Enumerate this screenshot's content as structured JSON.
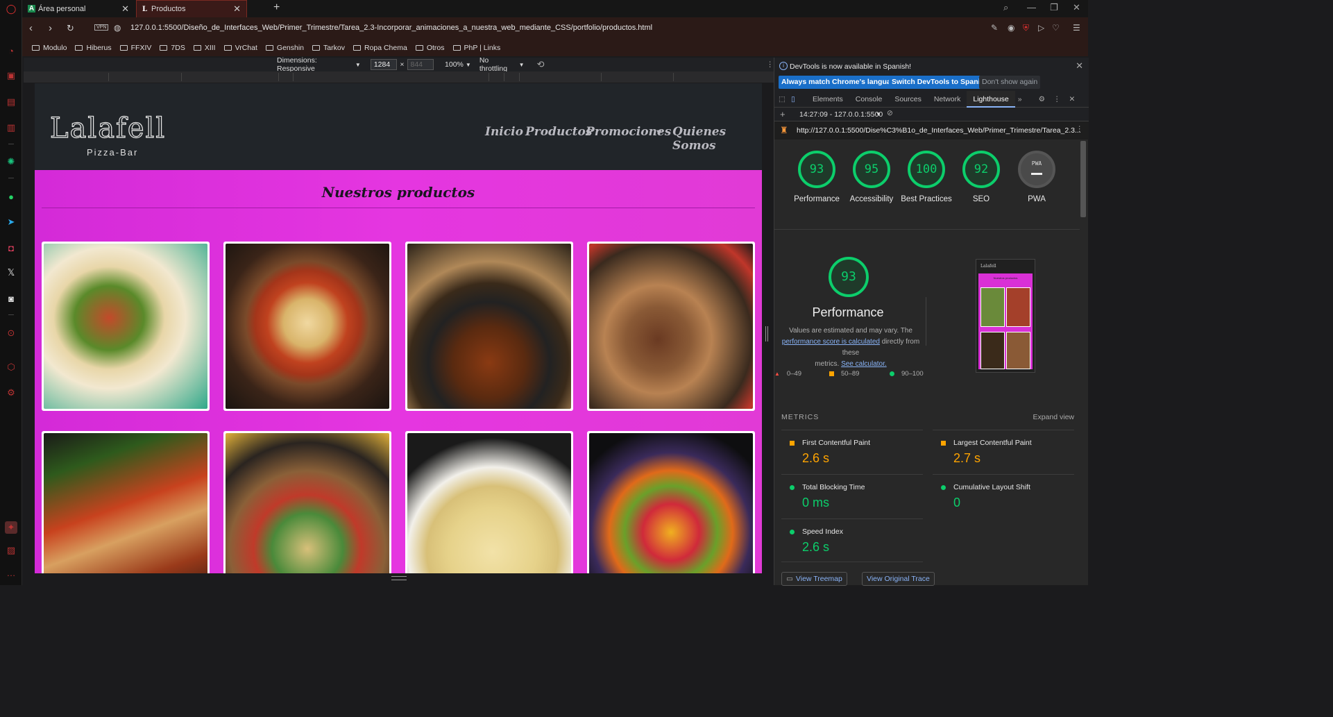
{
  "browser": {
    "tabs": [
      {
        "title": "Área personal",
        "favicon": "A"
      },
      {
        "title": "Productos",
        "favicon": "L"
      }
    ],
    "url": "127.0.0.1:5500/Diseño_de_Interfaces_Web/Primer_Trimestre/Tarea_2.3-Incorporar_animaciones_a_nuestra_web_mediante_CSS/portfolio/productos.html",
    "vpn_label": "VPN",
    "bookmarks": [
      "Modulo",
      "Hiberus",
      "FFXIV",
      "7DS",
      "XIII",
      "VrChat",
      "Genshin",
      "Tarkov",
      "Ropa Chema",
      "Otros",
      "PhP | Links"
    ]
  },
  "device_toolbar": {
    "dimensions": "Dimensions: Responsive",
    "width": "1284",
    "height_placeholder": "844",
    "times": "×",
    "zoom": "100%",
    "throttling": "No throttling"
  },
  "site": {
    "logo": "Lalafell",
    "logo_sub": "Pizza-Bar",
    "menu": [
      "Inicio",
      "Productos",
      "Promociones",
      "Quienes Somos"
    ],
    "section_title": "Nuestros productos",
    "products": [
      "tacos",
      "pizza",
      "stew",
      "steak",
      "lasagna",
      "chickpea-salad",
      "pasta",
      "fruit-salad"
    ]
  },
  "devtools": {
    "info": "DevTools is now available in Spanish!",
    "btn_match": "Always match Chrome's language",
    "btn_switch": "Switch DevTools to Spanish",
    "btn_dont": "Don't show again",
    "tabs": [
      "Elements",
      "Console",
      "Sources",
      "Network",
      "Lighthouse"
    ],
    "report": "14:27:09 - 127.0.0.1:5500",
    "report_url": "http://127.0.0.1:5500/Dise%C3%B1o_de_Interfaces_Web/Primer_Trimestre/Tarea_2.3...",
    "scores": [
      {
        "value": "93",
        "label": "Performance"
      },
      {
        "value": "95",
        "label": "Accessibility"
      },
      {
        "value": "100",
        "label": "Best Practices"
      },
      {
        "value": "92",
        "label": "SEO"
      },
      {
        "value": "PWA",
        "label": "PWA"
      }
    ],
    "perf_score": "93",
    "perf_title": "Performance",
    "perf_desc_1": "Values are estimated and may vary. The",
    "perf_link_1": "performance score is calculated",
    "perf_desc_2": "directly from these",
    "perf_desc_3": "metrics.",
    "perf_link_2": "See calculator.",
    "legend": [
      "0–49",
      "50–89",
      "90–100"
    ],
    "metrics_label": "METRICS",
    "expand_label": "Expand view",
    "metrics": [
      {
        "name": "First Contentful Paint",
        "value": "2.6 s",
        "status": "orange"
      },
      {
        "name": "Largest Contentful Paint",
        "value": "2.7 s",
        "status": "orange"
      },
      {
        "name": "Total Blocking Time",
        "value": "0 ms",
        "status": "green"
      },
      {
        "name": "Cumulative Layout Shift",
        "value": "0",
        "status": "green"
      },
      {
        "name": "Speed Index",
        "value": "2.6 s",
        "status": "green"
      }
    ],
    "btn_treemap": "View Treemap",
    "btn_trace": "View Original Trace",
    "thumb_logo": "Lalafell",
    "thumb_title": "Nuestros productos"
  },
  "colors": {
    "magenta": "#e536e0",
    "green": "#0cce6b",
    "orange": "#ffa400",
    "link_blue": "#8ab4f8"
  }
}
